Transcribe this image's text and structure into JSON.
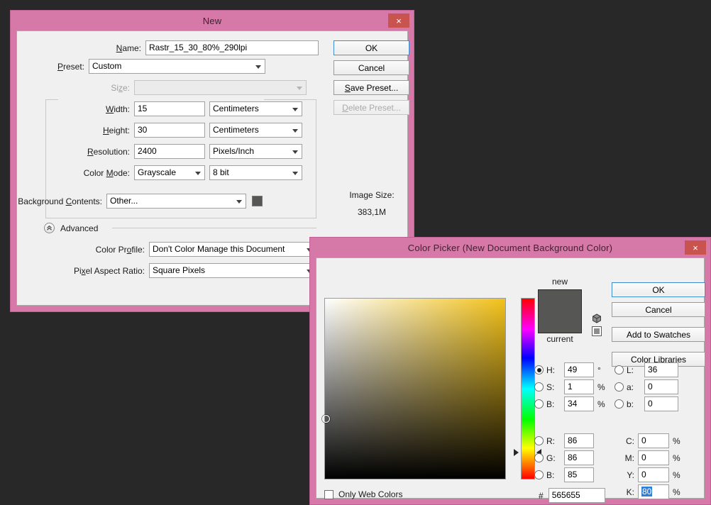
{
  "new_dialog": {
    "title": "New",
    "close_label": "×",
    "name_label": "Name:",
    "name_value": "Rastr_15_30_80%_290lpi",
    "preset_label": "Preset:",
    "preset_value": "Custom",
    "size_label": "Size:",
    "size_value": "",
    "width_label": "Width:",
    "width_value": "15",
    "width_unit": "Centimeters",
    "height_label": "Height:",
    "height_value": "30",
    "height_unit": "Centimeters",
    "resolution_label": "Resolution:",
    "resolution_value": "2400",
    "resolution_unit": "Pixels/Inch",
    "color_mode_label": "Color Mode:",
    "color_mode_value": "Grayscale",
    "color_depth_value": "8 bit",
    "background_label": "Background Contents:",
    "background_value": "Other...",
    "background_swatch_color": "#565655",
    "advanced_label": "Advanced",
    "color_profile_label": "Color Profile:",
    "color_profile_value": "Don't Color Manage this Document",
    "pixel_aspect_label": "Pixel Aspect Ratio:",
    "pixel_aspect_value": "Square Pixels",
    "ok_label": "OK",
    "cancel_label": "Cancel",
    "save_preset_label": "Save Preset...",
    "delete_preset_label": "Delete Preset...",
    "image_size_label": "Image Size:",
    "image_size_value": "383,1M"
  },
  "color_picker": {
    "title": "Color Picker (New Document Background Color)",
    "close_label": "×",
    "new_label": "new",
    "current_label": "current",
    "new_color": "#565655",
    "current_color": "#565655",
    "ok_label": "OK",
    "cancel_label": "Cancel",
    "add_swatches_label": "Add to Swatches",
    "color_libraries_label": "Color Libraries",
    "only_web_colors_label": "Only Web Colors",
    "hex_label": "#",
    "hex_value": "565655",
    "hsb": [
      {
        "key": "H",
        "label": "H:",
        "value": "49",
        "unit": "°",
        "selected": true
      },
      {
        "key": "S",
        "label": "S:",
        "value": "1",
        "unit": "%",
        "selected": false
      },
      {
        "key": "B",
        "label": "B:",
        "value": "34",
        "unit": "%",
        "selected": false
      }
    ],
    "rgb": [
      {
        "key": "R",
        "label": "R:",
        "value": "86",
        "unit": "",
        "selected": false
      },
      {
        "key": "G",
        "label": "G:",
        "value": "86",
        "unit": "",
        "selected": false
      },
      {
        "key": "B",
        "label": "B:",
        "value": "85",
        "unit": "",
        "selected": false
      }
    ],
    "lab": [
      {
        "key": "L",
        "label": "L:",
        "value": "36",
        "unit": "",
        "selected": false
      },
      {
        "key": "a",
        "label": "a:",
        "value": "0",
        "unit": "",
        "selected": false
      },
      {
        "key": "b",
        "label": "b:",
        "value": "0",
        "unit": "",
        "selected": false
      }
    ],
    "cmyk": [
      {
        "key": "C",
        "label": "C:",
        "value": "0",
        "unit": "%"
      },
      {
        "key": "M",
        "label": "M:",
        "value": "0",
        "unit": "%"
      },
      {
        "key": "Y",
        "label": "Y:",
        "value": "0",
        "unit": "%"
      },
      {
        "key": "K",
        "label": "K:",
        "value": "80",
        "unit": "%"
      }
    ],
    "cmyk_selected_key": "K",
    "gamut_warning_icon": "cube-icon",
    "web_safe_icon": "square-icon"
  }
}
